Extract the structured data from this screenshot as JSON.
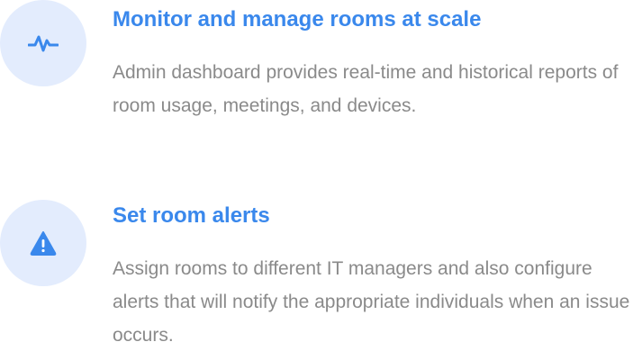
{
  "features": [
    {
      "icon": "activity-pulse-icon",
      "title": "Monitor and manage rooms at scale",
      "description": "Admin dashboard provides real-time and historical reports of room usage, meetings, and devices."
    },
    {
      "icon": "warning-triangle-icon",
      "title": "Set room alerts",
      "description": "Assign rooms to different IT managers and also configure alerts that will notify the appropriate individuals when an issue occurs."
    }
  ],
  "colors": {
    "accent": "#3a88ec",
    "icon_bg": "#e3ecfd",
    "body_text": "#8a8a8a"
  }
}
